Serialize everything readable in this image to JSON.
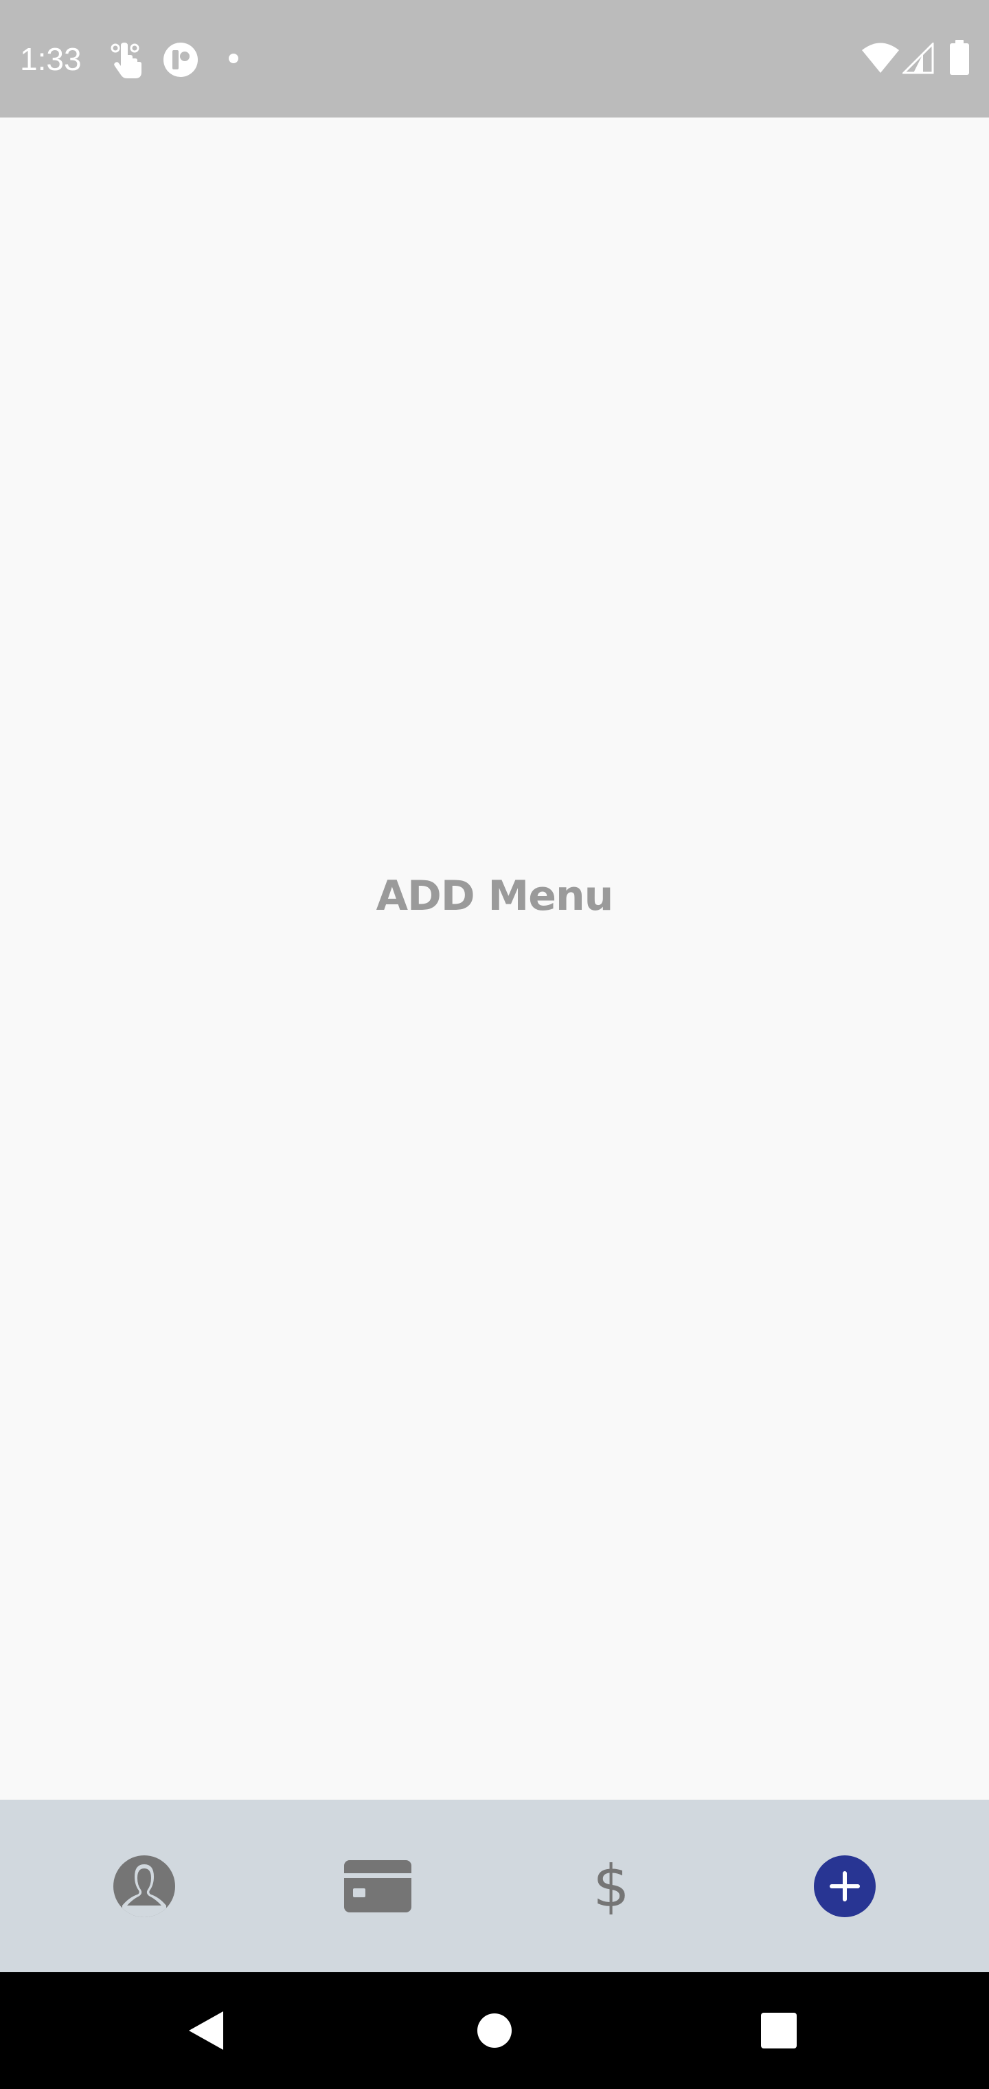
{
  "status_bar": {
    "time": "1:33",
    "left_icons": [
      "touch-gesture-icon",
      "app-status-icon",
      "notification-dot-icon"
    ],
    "right_icons": [
      "wifi-icon",
      "cell-signal-icon",
      "battery-icon"
    ],
    "background": "#bbbbbb"
  },
  "main": {
    "label": "ADD Menu",
    "label_color": "#9a9a9a",
    "background": "#f9f9f9"
  },
  "bottom_nav": {
    "background": "#d1d8de",
    "items": [
      {
        "name": "profile",
        "icon": "profile-icon",
        "active": false
      },
      {
        "name": "cards",
        "icon": "credit-card-icon",
        "active": false
      },
      {
        "name": "payments",
        "icon": "dollar-icon",
        "icon_glyph": "$",
        "active": false
      },
      {
        "name": "add",
        "icon": "add-circle-icon",
        "active": true
      }
    ],
    "active_color": "#283593",
    "inactive_color": "#757575"
  },
  "system_nav": {
    "buttons": [
      "back-icon",
      "home-icon",
      "recents-icon"
    ]
  }
}
